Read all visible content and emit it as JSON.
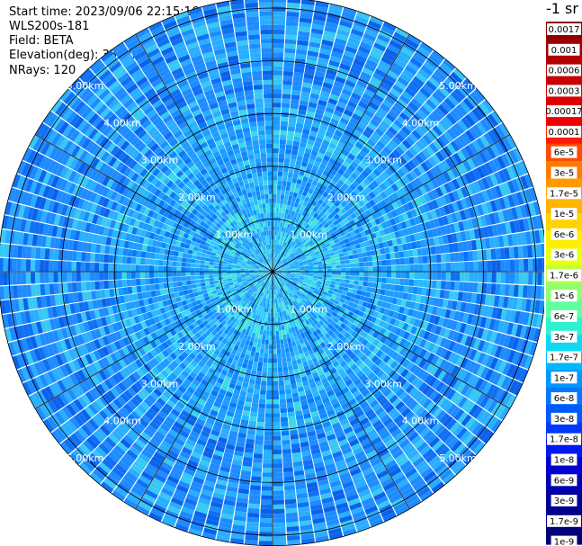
{
  "header": {
    "start_time": "Start time: 2023/09/06 22:15:16",
    "instrument": "WLS200s-181",
    "field": "Field: BETA",
    "elevation": "Elevation(deg): 35.30",
    "nrays": "NRays: 120"
  },
  "chart_data": {
    "type": "heatmap",
    "projection": "polar-ppi",
    "n_rays": 120,
    "range_rings_km": [
      1,
      2,
      3,
      4,
      5
    ],
    "ring_labels": [
      "1.00km",
      "2.00km",
      "3.00km",
      "4.00km",
      "5.00km"
    ],
    "outer_range_km": 5.2,
    "spoke_step_deg": 30,
    "colorbar": {
      "unit_label": "-1 sr",
      "tick_labels": [
        "0.0017",
        "0.001",
        "0.0006",
        "0.0003",
        "0.00017",
        "0.0001",
        "6e-5",
        "3e-5",
        "1.7e-5",
        "1e-5",
        "6e-6",
        "3e-6",
        "1.7e-6",
        "1e-6",
        "6e-7",
        "3e-7",
        "1.7e-7",
        "1e-7",
        "6e-8",
        "3e-8",
        "1.7e-8",
        "1e-8",
        "6e-9",
        "3e-9",
        "1.7e-9",
        "1e-9"
      ],
      "segment_colors": [
        "#8b0000",
        "#a00000",
        "#b40000",
        "#c80000",
        "#dc0000",
        "#f00000",
        "#ff1a00",
        "#ff4a00",
        "#ff7a00",
        "#ff9a00",
        "#ffb400",
        "#ffd400",
        "#ffee00",
        "#e8ff10",
        "#c0ff40",
        "#90ff70",
        "#60ffa0",
        "#30f0d0",
        "#10d8f0",
        "#00b8ff",
        "#0098ff",
        "#0078ff",
        "#0058ff",
        "#0038ff",
        "#0018f0",
        "#0000d0",
        "#0000b0",
        "#00009a",
        "#000088",
        "#000078"
      ],
      "dark_label_indices": [
        0,
        1,
        2,
        3
      ]
    },
    "dominant_range": "1e-8 to 3e-7 (mostly ~3e-8 to 1e-7)"
  }
}
